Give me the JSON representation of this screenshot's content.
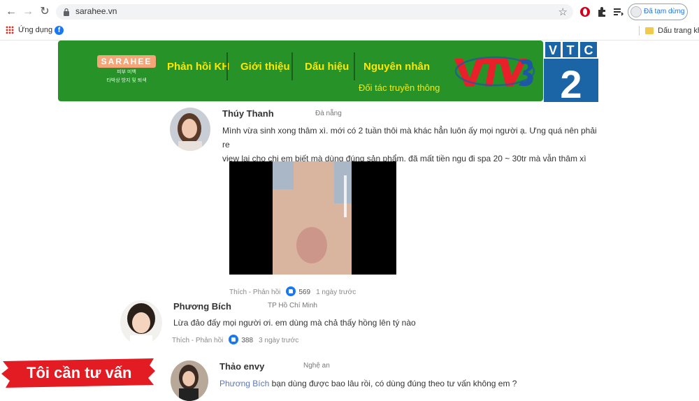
{
  "browser": {
    "url": "sarahee.vn",
    "profile_status": "Đã tạm dừng",
    "bookmarks": {
      "apps_label": "Ứng dụng",
      "other_label": "Dấu trang khác"
    }
  },
  "banner": {
    "logo_text": "SARAHEE",
    "logo_sub_1": "피부 미백",
    "logo_sub_2": "타박상 방지 및 퇴색",
    "menu": [
      "Phản hồi KH",
      "Giới thiệu",
      "Dấu hiệu",
      "Nguyên nhân"
    ],
    "partner_text": "Đối tác truyền thông",
    "vtv_logo": "VTV3",
    "vtc_logo_text": "VTC",
    "vtc_logo_number": "2"
  },
  "comments": [
    {
      "name": "Thúy Thanh",
      "location": "Đà nẵng",
      "text_line1": "Mình vừa sinh xong thâm xì. mới có 2 tuần thôi mà khác hẳn luôn ấy mọi người ạ. Ưng quá nên phải re",
      "text_line2": "view lại cho chị em biết mà dùng đúng sản phẩm. đã mất tiền ngu đi spa 20 ~ 30tr mà vẫn thâm xì",
      "actions": "Thích - Phản hồi",
      "likes": "569",
      "time": "1 ngày trước"
    },
    {
      "name": "Phương Bích",
      "location": "TP Hồ Chí Minh",
      "text": "Lừa đảo đấy mọi người ơi. em dùng mà chả thấy hồng lên tý nào",
      "actions": "Thích - Phản hồi",
      "likes": "388",
      "time": "3 ngày trước"
    },
    {
      "name": "Thảo envy",
      "location": "Nghệ an",
      "mention": "Phương Bích",
      "text": "bạn dùng được bao lâu rồi, có dùng đúng theo tư vấn không em ?"
    }
  ],
  "cta": {
    "label": "Tôi cần tư vấn"
  },
  "colors": {
    "banner_green": "#279228",
    "menu_yellow": "#ffe600",
    "cta_red": "#e31b23",
    "vtc_blue": "#1b64a6"
  }
}
